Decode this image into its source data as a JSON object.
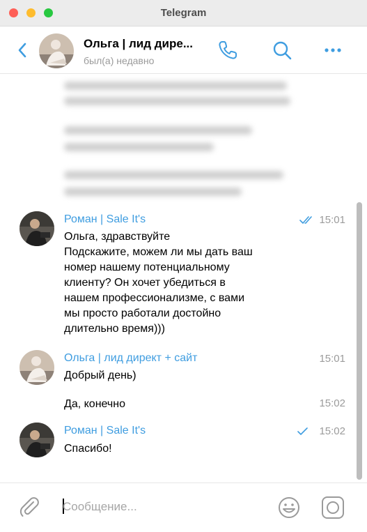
{
  "window": {
    "title": "Telegram"
  },
  "header": {
    "name": "Ольга | лид дире...",
    "status": "был(а) недавно"
  },
  "messages": [
    {
      "author": "Роман | Sale It's",
      "time": "15:01",
      "read_state": "read",
      "lines": [
        "Ольга, здравствуйте",
        "Подскажите, можем ли мы дать ваш",
        "номер нашему потенциальному",
        "клиенту? Он хочет убедиться в",
        "нашем профессионализме, с вами",
        "мы просто работали достойно",
        "длительно время)))"
      ]
    },
    {
      "author": "Ольга | лид директ + сайт",
      "time": "15:01",
      "text": "Добрый день)"
    },
    {
      "time": "15:02",
      "text": "Да, конечно"
    },
    {
      "author": "Роман | Sale It's",
      "time": "15:02",
      "read_state": "sent",
      "text": "Спасибо!"
    }
  ],
  "composer": {
    "placeholder": "Сообщение..."
  },
  "colors": {
    "accent": "#3f9de0",
    "author_name": "#3f9de0",
    "time": "#9b9b9b"
  },
  "icons": [
    "back-chevron-icon",
    "phone-icon",
    "search-icon",
    "more-icon",
    "double-check-icon",
    "check-icon",
    "paperclip-icon",
    "emoji-icon",
    "voice-message-icon"
  ]
}
